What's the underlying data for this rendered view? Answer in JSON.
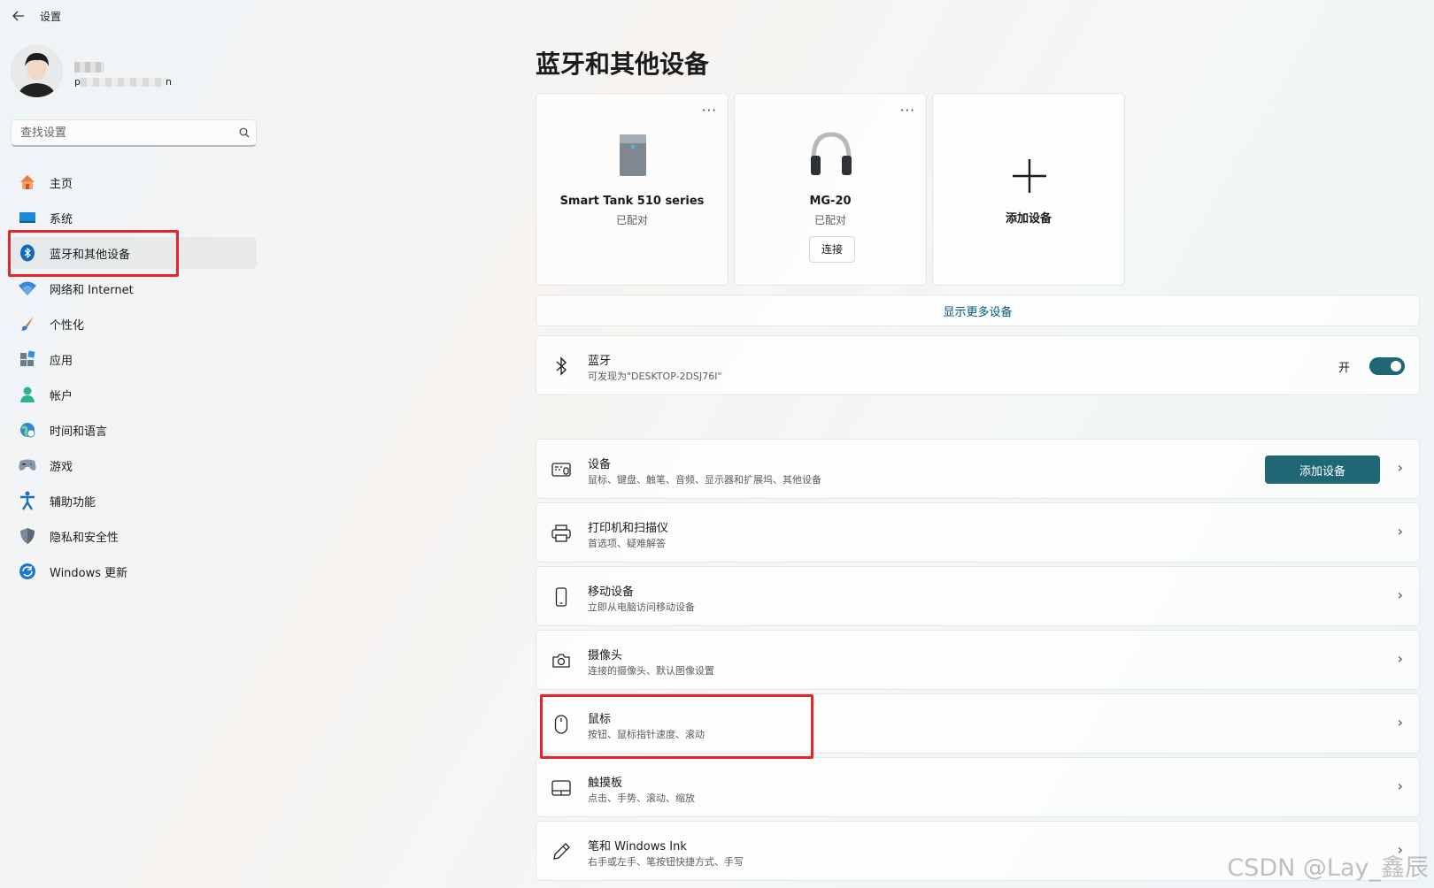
{
  "window": {
    "title": "设置",
    "back_icon": "arrow-left-icon"
  },
  "profile": {
    "name_masked": "",
    "email_prefix": "p",
    "email_suffix": "n"
  },
  "search": {
    "placeholder": "查找设置",
    "icon": "search-icon"
  },
  "nav": {
    "items": [
      {
        "label": "主页",
        "icon": "home-icon"
      },
      {
        "label": "系统",
        "icon": "system-icon"
      },
      {
        "label": "蓝牙和其他设备",
        "icon": "bluetooth-icon",
        "active": true
      },
      {
        "label": "网络和 Internet",
        "icon": "wifi-icon"
      },
      {
        "label": "个性化",
        "icon": "brush-icon"
      },
      {
        "label": "应用",
        "icon": "apps-icon"
      },
      {
        "label": "帐户",
        "icon": "account-icon"
      },
      {
        "label": "时间和语言",
        "icon": "globe-clock-icon"
      },
      {
        "label": "游戏",
        "icon": "gamepad-icon"
      },
      {
        "label": "辅助功能",
        "icon": "accessibility-icon"
      },
      {
        "label": "隐私和安全性",
        "icon": "shield-icon"
      },
      {
        "label": "Windows 更新",
        "icon": "update-icon"
      }
    ]
  },
  "main": {
    "title": "蓝牙和其他设备",
    "devices": [
      {
        "name": "Smart Tank 510 series",
        "status": "已配对",
        "more": "···",
        "icon": "printer-device-icon"
      },
      {
        "name": "MG-20",
        "status": "已配对",
        "more": "···",
        "action": "连接",
        "icon": "headphones-icon"
      }
    ],
    "add_card": {
      "label": "添加设备",
      "icon": "plus-icon"
    },
    "show_more": "显示更多设备",
    "bluetooth": {
      "title": "蓝牙",
      "subtitle": "可发现为\"DESKTOP-2DSJ76I\"",
      "toggle_label": "开",
      "on": true
    },
    "rows": [
      {
        "title": "设备",
        "subtitle": "鼠标、键盘、触笔、音频、显示器和扩展坞、其他设备",
        "button": "添加设备",
        "icon": "devices-icon"
      },
      {
        "title": "打印机和扫描仪",
        "subtitle": "首选项、疑难解答",
        "icon": "printer-icon"
      },
      {
        "title": "移动设备",
        "subtitle": "立即从电脑访问移动设备",
        "icon": "phone-icon"
      },
      {
        "title": "摄像头",
        "subtitle": "连接的摄像头、默认图像设置",
        "icon": "camera-icon"
      },
      {
        "title": "鼠标",
        "subtitle": "按钮、鼠标指针速度、滚动",
        "icon": "mouse-icon"
      },
      {
        "title": "触摸板",
        "subtitle": "点击、手势、滚动、缩放",
        "icon": "touchpad-icon"
      },
      {
        "title": "笔和 Windows Ink",
        "subtitle": "右手或左手、笔按钮快捷方式、手写",
        "icon": "pen-icon"
      }
    ]
  },
  "watermark": "CSDN @Lay_鑫辰",
  "colors": {
    "accent": "#1f6775",
    "highlight": "#e8242b",
    "link": "#005a7e"
  }
}
